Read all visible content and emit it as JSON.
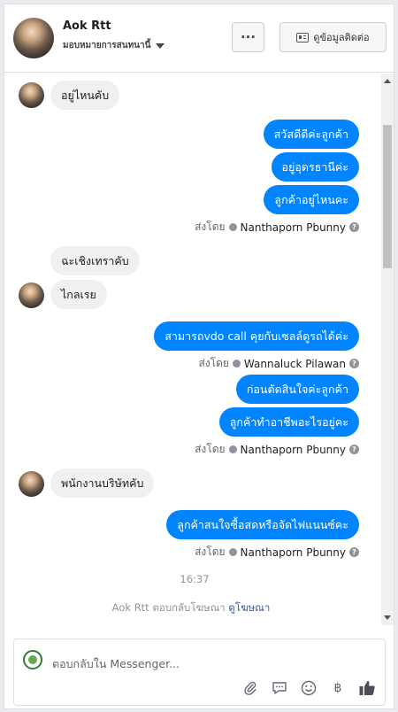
{
  "header": {
    "name": "Aok Rtt",
    "subtitle": "มอบหมายการสนทนานี้",
    "more_label": "···",
    "contact_label": "ดูข้อมูลติดต่อ"
  },
  "messages": [
    {
      "type": "in",
      "text": "อยู่ไหนคับ"
    },
    {
      "type": "out",
      "text": "สวัสดีดีค่ะลูกค้า"
    },
    {
      "type": "out",
      "text": "อยู่อุดรธานีค่ะ"
    },
    {
      "type": "out",
      "text": "ลูกค้าอยู่ไหนคะ"
    },
    {
      "type": "sent",
      "by": "ส่งโดย",
      "name": "Nanthaporn Pbunny"
    },
    {
      "type": "in",
      "text": "ฉะเชิงเทราคับ"
    },
    {
      "type": "in",
      "text": "ไกลเรย"
    },
    {
      "type": "out",
      "text": "สามารถvdo call  คุยกับเซลล์ดูรถได้ค่ะ"
    },
    {
      "type": "sent",
      "by": "ส่งโดย",
      "name": "Wannaluck Pilawan"
    },
    {
      "type": "out",
      "text": "ก่อนตัดสินใจค่ะลูกค้า"
    },
    {
      "type": "out",
      "text": "ลูกค้าทำอาชีพอะไรอยู่คะ"
    },
    {
      "type": "sent",
      "by": "ส่งโดย",
      "name": "Nanthaporn Pbunny"
    },
    {
      "type": "in",
      "text": "พนักงานบริษัทคับ"
    },
    {
      "type": "out",
      "text": "ลูกค้าสนใจซื้อสดหรือจัดไฟแนนซ์คะ"
    },
    {
      "type": "sent",
      "by": "ส่งโดย",
      "name": "Nanthaporn Pbunny"
    }
  ],
  "timestamp": "16:37",
  "ad_reply": {
    "text": "Aok Rtt ตอบกลับโฆษณา",
    "link": "ดูโฆษณา"
  },
  "composer": {
    "placeholder": "ตอบกลับใน Messenger...",
    "tools": [
      "attachment-icon",
      "saved-reply-icon",
      "emoji-icon",
      "baht-icon",
      "like-icon"
    ]
  },
  "colors": {
    "accent": "#0084ff",
    "incoming_bubble": "#f1f0f0"
  }
}
